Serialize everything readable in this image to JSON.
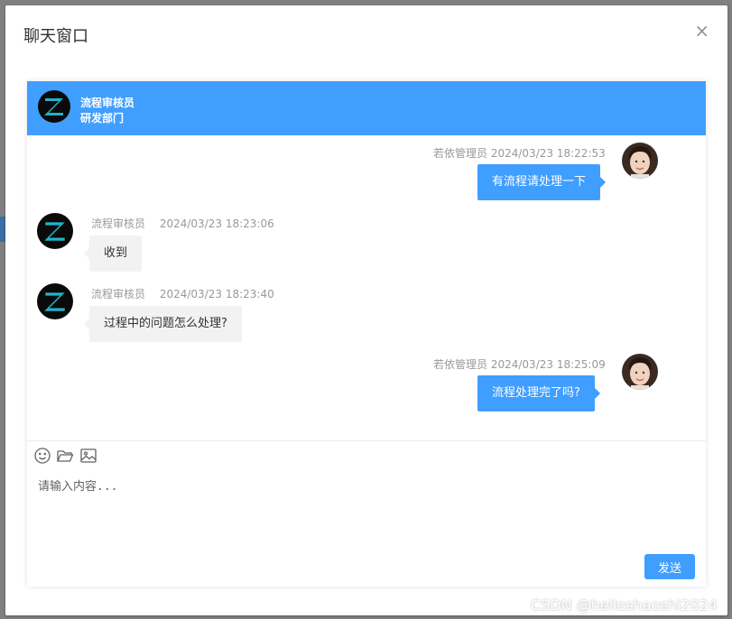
{
  "dialog": {
    "title": "聊天窗口",
    "close_glyph": "×"
  },
  "chat_header": {
    "name": "流程审核员",
    "department": "研发部门",
    "avatar_letter": "Z"
  },
  "messages": [
    {
      "sender": "若依管理员",
      "time": "2024/03/23 18:22:53",
      "text": "有流程请处理一下",
      "mine": true
    },
    {
      "sender": "流程审核员",
      "time": "2024/03/23 18:23:06",
      "text": "收到",
      "mine": false
    },
    {
      "sender": "流程审核员",
      "time": "2024/03/23 18:23:40",
      "text": "过程中的问题怎么处理?",
      "mine": false
    },
    {
      "sender": "若依管理员",
      "time": "2024/03/23 18:25:09",
      "text": "流程处理完了吗?",
      "mine": true
    }
  ],
  "toolbar": {
    "icons": [
      "emoji-icon",
      "folder-icon",
      "image-icon"
    ]
  },
  "input": {
    "placeholder": "请输入内容..."
  },
  "send_button": {
    "label": "发送"
  },
  "watermark": "CSDN @helloshaoshi2024",
  "colors": {
    "primary": "#409eff",
    "bubble_other": "#f2f2f2",
    "logo_teal": "#1fb5c9"
  }
}
